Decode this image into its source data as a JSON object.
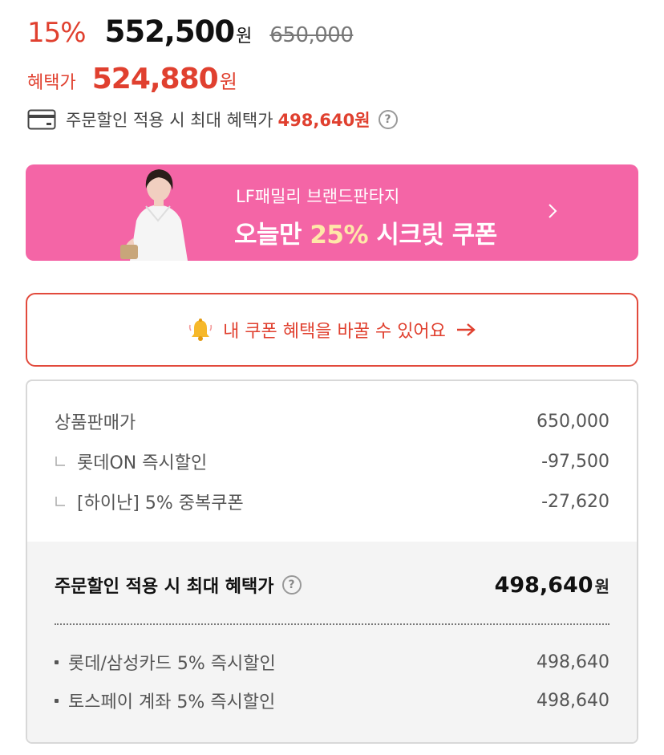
{
  "price": {
    "discount_rate": "15%",
    "sale_price": "552,500",
    "sale_currency": "원",
    "original_price": "650,000"
  },
  "benefit": {
    "label": "혜택가",
    "price": "524,880",
    "currency": "원"
  },
  "max_benefit": {
    "text": "주문할인 적용 시 최대 혜택가",
    "amount": "498,640원",
    "icon": "credit-card-icon",
    "help_icon": "?"
  },
  "promo": {
    "subtitle": "LF패밀리 브랜드판타지",
    "title_prefix": "오늘만 ",
    "title_highlight": "25%",
    "title_suffix": " 시크릿 쿠폰",
    "bg_color": "#f465a6"
  },
  "coupon_button": {
    "label": "내 쿠폰 혜택을 바꿀 수 있어요",
    "icon": "bell-icon",
    "arrow": "arrow-right-icon"
  },
  "breakdown": {
    "rows": [
      {
        "label": "상품판매가",
        "value": "650,000"
      },
      {
        "label": "롯데ON 즉시할인",
        "value": "-97,500"
      },
      {
        "label": "[하이난] 5% 중복쿠폰",
        "value": "-27,620"
      }
    ],
    "total_label": "주문할인 적용 시 최대 혜택가",
    "total_help": "?",
    "total_value": "498,640",
    "total_currency": "원",
    "card_discounts": [
      {
        "label": "롯데/삼성카드 5% 즉시할인",
        "value": "498,640"
      },
      {
        "label": "토스페이 계좌 5% 즉시할인",
        "value": "498,640"
      }
    ]
  },
  "colors": {
    "accent": "#e0402f",
    "promo_pink": "#f465a6",
    "panel_bg": "#f4f4f4"
  }
}
